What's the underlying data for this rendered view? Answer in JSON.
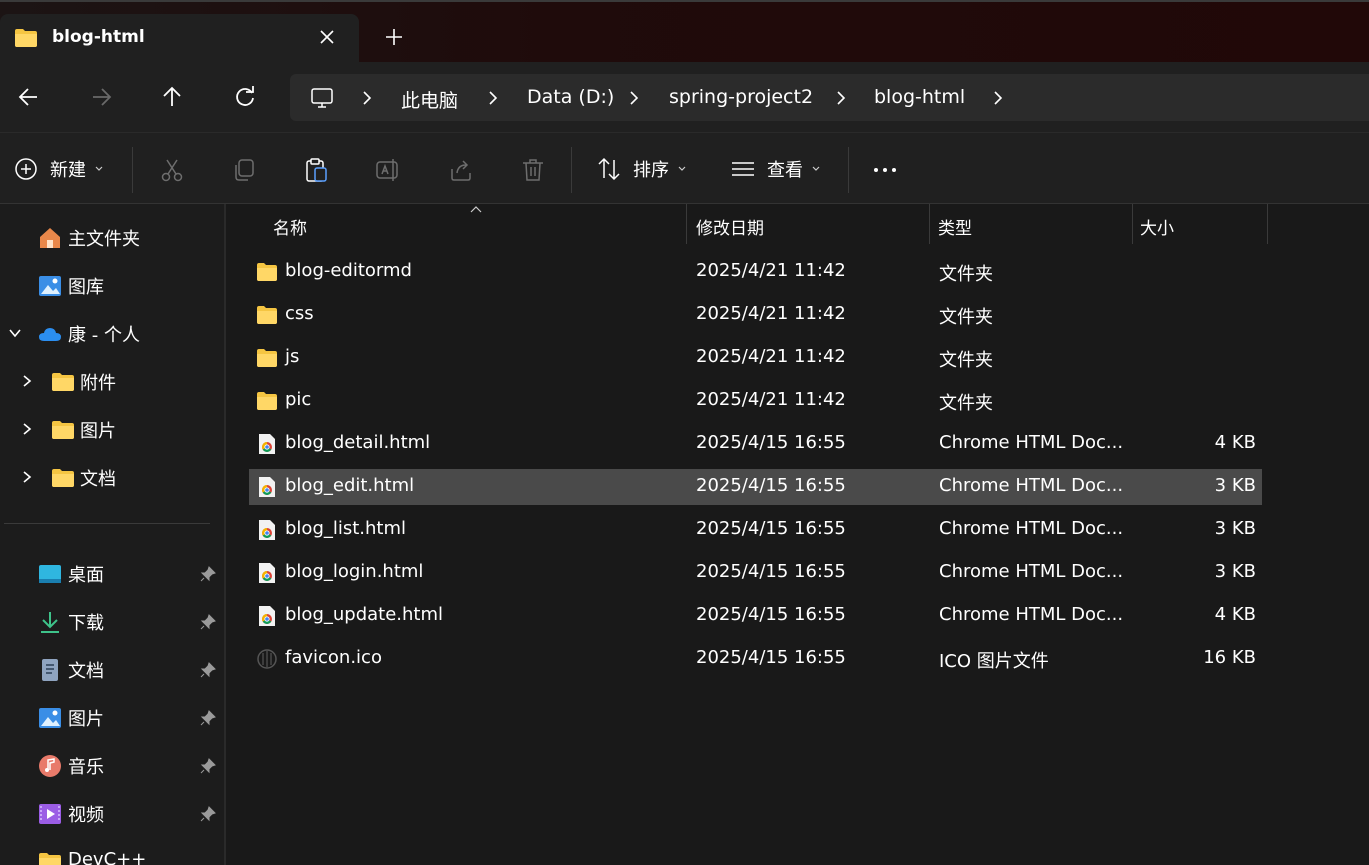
{
  "tab": {
    "title": "blog-html"
  },
  "breadcrumb": [
    "此电脑",
    "Data (D:)",
    "spring-project2",
    "blog-html"
  ],
  "toolbar": {
    "new_label": "新建",
    "sort_label": "排序",
    "view_label": "查看"
  },
  "sidebar": {
    "top_items": [
      {
        "label": "主文件夹",
        "icon": "home-icon"
      },
      {
        "label": "图库",
        "icon": "gallery-icon"
      },
      {
        "label": "康 - 个人",
        "icon": "onedrive-icon",
        "expanded": true
      }
    ],
    "onedrive_children": [
      {
        "label": "附件",
        "icon": "folder-icon"
      },
      {
        "label": "图片",
        "icon": "folder-icon"
      },
      {
        "label": "文档",
        "icon": "folder-icon"
      }
    ],
    "quick_access": [
      {
        "label": "桌面",
        "icon": "desktop-icon"
      },
      {
        "label": "下载",
        "icon": "download-icon"
      },
      {
        "label": "文档",
        "icon": "documents-icon"
      },
      {
        "label": "图片",
        "icon": "pictures-icon"
      },
      {
        "label": "音乐",
        "icon": "music-icon"
      },
      {
        "label": "视频",
        "icon": "videos-icon"
      },
      {
        "label": "DevC++",
        "icon": "folder-icon"
      }
    ]
  },
  "columns": {
    "name": "名称",
    "date": "修改日期",
    "type": "类型",
    "size": "大小"
  },
  "files": [
    {
      "name": "blog-editormd",
      "date": "2025/4/21 11:42",
      "type": "文件夹",
      "size": "",
      "icon": "folder-icon"
    },
    {
      "name": "css",
      "date": "2025/4/21 11:42",
      "type": "文件夹",
      "size": "",
      "icon": "folder-icon"
    },
    {
      "name": "js",
      "date": "2025/4/21 11:42",
      "type": "文件夹",
      "size": "",
      "icon": "folder-icon"
    },
    {
      "name": "pic",
      "date": "2025/4/21 11:42",
      "type": "文件夹",
      "size": "",
      "icon": "folder-icon"
    },
    {
      "name": "blog_detail.html",
      "date": "2025/4/15 16:55",
      "type": "Chrome HTML Doc...",
      "size": "4 KB",
      "icon": "chrome-html-icon"
    },
    {
      "name": "blog_edit.html",
      "date": "2025/4/15 16:55",
      "type": "Chrome HTML Doc...",
      "size": "3 KB",
      "icon": "chrome-html-icon",
      "selected": true
    },
    {
      "name": "blog_list.html",
      "date": "2025/4/15 16:55",
      "type": "Chrome HTML Doc...",
      "size": "3 KB",
      "icon": "chrome-html-icon"
    },
    {
      "name": "blog_login.html",
      "date": "2025/4/15 16:55",
      "type": "Chrome HTML Doc...",
      "size": "3 KB",
      "icon": "chrome-html-icon"
    },
    {
      "name": "blog_update.html",
      "date": "2025/4/15 16:55",
      "type": "Chrome HTML Doc...",
      "size": "4 KB",
      "icon": "chrome-html-icon"
    },
    {
      "name": "favicon.ico",
      "date": "2025/4/15 16:55",
      "type": "ICO 图片文件",
      "size": "16 KB",
      "icon": "ico-file-icon"
    }
  ],
  "colors": {
    "folder": "#f5c542",
    "selection": "#4a4a4a",
    "background": "#191919"
  }
}
